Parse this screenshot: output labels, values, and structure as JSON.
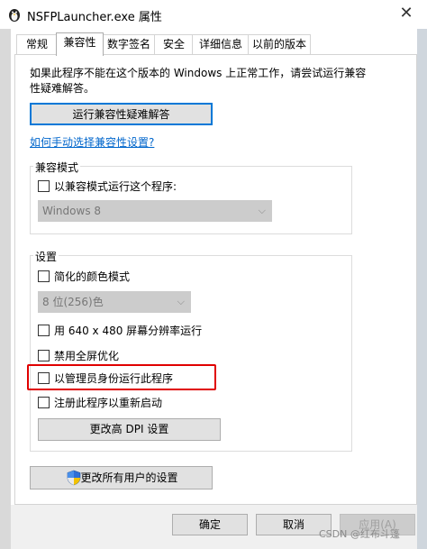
{
  "window": {
    "title": "NSFPLauncher.exe 属性",
    "close_glyph": "✕",
    "accent": "#0078d7"
  },
  "tabs": [
    {
      "label": "常规",
      "active": false
    },
    {
      "label": "兼容性",
      "active": true
    },
    {
      "label": "数字签名",
      "active": false
    },
    {
      "label": "安全",
      "active": false
    },
    {
      "label": "详细信息",
      "active": false
    },
    {
      "label": "以前的版本",
      "active": false
    }
  ],
  "compat": {
    "intro_line1": "如果此程序不能在这个版本的 Windows 上正常工作，请尝试运行兼容",
    "intro_line2": "性疑难解答。",
    "troubleshoot_label": "运行兼容性疑难解答",
    "manual_link": "如何手动选择兼容性设置?",
    "mode_group": {
      "label": "兼容模式",
      "checkbox_label": "以兼容模式运行这个程序:",
      "checked": false,
      "os_select": "Windows 8"
    },
    "settings_group": {
      "label": "设置",
      "reduced_color": {
        "label": "简化的颜色模式",
        "checked": false
      },
      "color_select": "8 位(256)色",
      "res_640": {
        "label": "用 640 x 480 屏幕分辨率运行",
        "checked": false
      },
      "disable_fullscreen": {
        "label": "禁用全屏优化",
        "checked": false
      },
      "run_as_admin": {
        "label": "以管理员身份运行此程序",
        "checked": false
      },
      "register_restart": {
        "label": "注册此程序以重新启动",
        "checked": false
      },
      "dpi_button": "更改高 DPI 设置"
    },
    "all_users_button": "更改所有用户的设置",
    "highlight_color": "#e00000"
  },
  "footer": {
    "ok": "确定",
    "cancel": "取消",
    "apply": "应用(A)",
    "watermark": "CSDN @红布斗篷"
  }
}
